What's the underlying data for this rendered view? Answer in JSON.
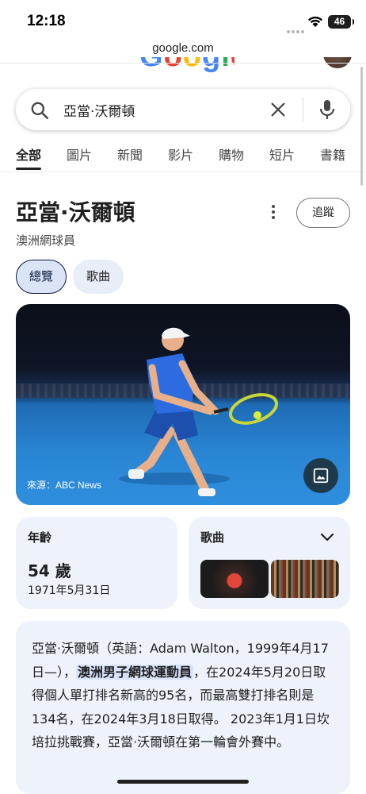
{
  "status_bar": {
    "time": "12:18",
    "battery": "46"
  },
  "browser": {
    "url": "google.com"
  },
  "google_logo": "Google",
  "search": {
    "query": "亞當·沃爾頓"
  },
  "tabs": [
    {
      "label": "全部",
      "active": true
    },
    {
      "label": "圖片",
      "active": false
    },
    {
      "label": "新聞",
      "active": false
    },
    {
      "label": "影片",
      "active": false
    },
    {
      "label": "購物",
      "active": false
    },
    {
      "label": "短片",
      "active": false
    },
    {
      "label": "書籍",
      "active": false
    }
  ],
  "knowledge_panel": {
    "title": "亞當·沃爾頓",
    "subtitle": "澳洲網球員",
    "follow_label": "追蹤",
    "chips": [
      "總覽",
      "歌曲"
    ],
    "image_source": "來源：ABC News",
    "age": {
      "label": "年齡",
      "value": "54 歲",
      "birth_date": "1971年5月31日"
    },
    "songs": {
      "label": "歌曲"
    },
    "description": {
      "part1": "亞當·沃爾頓（英語：Adam Walton，1999年4月17日—），",
      "highlight": "澳洲男子網球運動員",
      "part2": "，在2024年5月20日取得個人單打排名新高的95名，而最高雙打排名則是134名，在2024年3月18日取得。 2023年1月1日坎培拉挑戰賽，亞當·沃爾頓在第一輪會外賽中。"
    }
  },
  "colors": {
    "accent": "#0b1a3a",
    "chip_bg": "#dbe4f7",
    "card_bg": "#eef2fb",
    "highlight": "#d7e3fb"
  }
}
